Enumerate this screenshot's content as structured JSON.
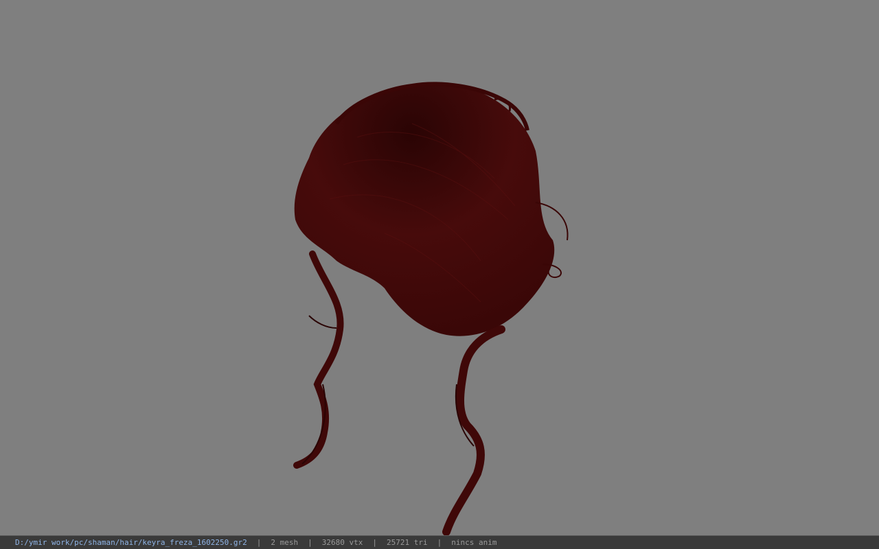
{
  "viewport": {
    "background_color": "#7f7f7f",
    "model_color": "#3d0808",
    "model_description_icon": "hair-model-render"
  },
  "status_bar": {
    "file_path": "D:/ymir work/pc/shaman/hair/keyra_freza_1602250.gr2",
    "mesh": "2 mesh",
    "vertices": "32680 vtx",
    "triangles": "25721 tri",
    "anim": "nincs anim",
    "separator": "|"
  }
}
